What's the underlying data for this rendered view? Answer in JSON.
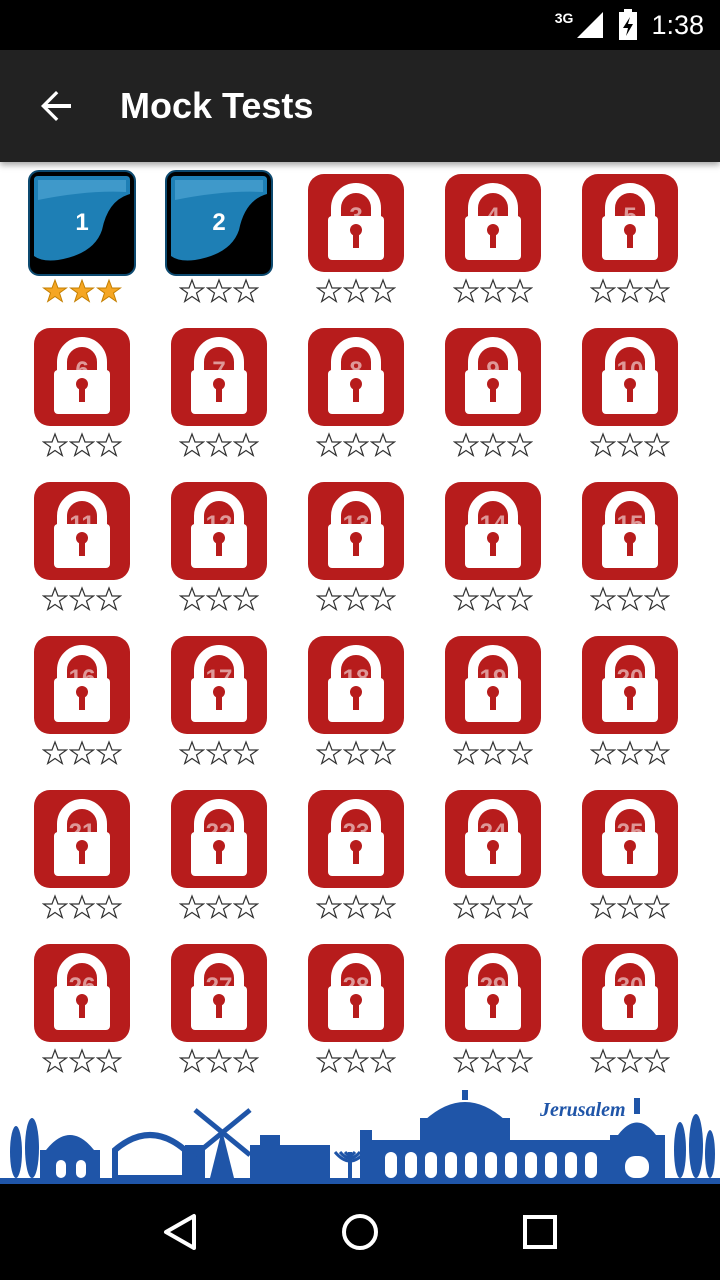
{
  "status_bar": {
    "network": "3G",
    "time": "1:38"
  },
  "app_bar": {
    "title": "Mock Tests",
    "back_icon": "arrow-left-icon"
  },
  "colors": {
    "lock_red": "#B71C1C",
    "tile_blue": "#1E7FB5",
    "star_gold": "#F5A623",
    "skyline_blue": "#1F55A8"
  },
  "tests": [
    {
      "number": "1",
      "locked": false,
      "stars": 3
    },
    {
      "number": "2",
      "locked": false,
      "stars": 0
    },
    {
      "number": "3",
      "locked": true,
      "stars": 0
    },
    {
      "number": "4",
      "locked": true,
      "stars": 0
    },
    {
      "number": "5",
      "locked": true,
      "stars": 0
    },
    {
      "number": "6",
      "locked": true,
      "stars": 0
    },
    {
      "number": "7",
      "locked": true,
      "stars": 0
    },
    {
      "number": "8",
      "locked": true,
      "stars": 0
    },
    {
      "number": "9",
      "locked": true,
      "stars": 0
    },
    {
      "number": "10",
      "locked": true,
      "stars": 0
    },
    {
      "number": "11",
      "locked": true,
      "stars": 0
    },
    {
      "number": "12",
      "locked": true,
      "stars": 0
    },
    {
      "number": "13",
      "locked": true,
      "stars": 0
    },
    {
      "number": "14",
      "locked": true,
      "stars": 0
    },
    {
      "number": "15",
      "locked": true,
      "stars": 0
    },
    {
      "number": "16",
      "locked": true,
      "stars": 0
    },
    {
      "number": "17",
      "locked": true,
      "stars": 0
    },
    {
      "number": "18",
      "locked": true,
      "stars": 0
    },
    {
      "number": "19",
      "locked": true,
      "stars": 0
    },
    {
      "number": "20",
      "locked": true,
      "stars": 0
    },
    {
      "number": "21",
      "locked": true,
      "stars": 0
    },
    {
      "number": "22",
      "locked": true,
      "stars": 0
    },
    {
      "number": "23",
      "locked": true,
      "stars": 0
    },
    {
      "number": "24",
      "locked": true,
      "stars": 0
    },
    {
      "number": "25",
      "locked": true,
      "stars": 0
    },
    {
      "number": "26",
      "locked": true,
      "stars": 0
    },
    {
      "number": "27",
      "locked": true,
      "stars": 0
    },
    {
      "number": "28",
      "locked": true,
      "stars": 0
    },
    {
      "number": "29",
      "locked": true,
      "stars": 0
    },
    {
      "number": "30",
      "locked": true,
      "stars": 0
    }
  ],
  "max_stars": 3,
  "banner": {
    "text": "Jerusalem"
  },
  "nav": {
    "back_icon": "triangle-back-icon",
    "home_icon": "circle-home-icon",
    "recents_icon": "square-recents-icon"
  }
}
